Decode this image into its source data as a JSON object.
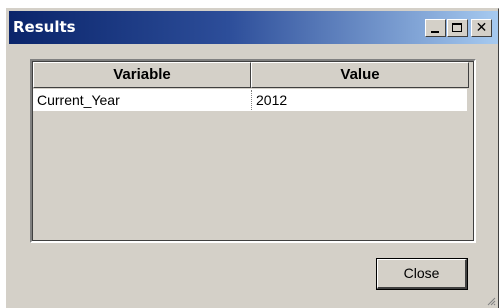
{
  "window": {
    "title": "Results",
    "controls": {
      "minimize": "minimize",
      "maximize": "maximize",
      "close_glyph": "✕"
    }
  },
  "grid": {
    "columns": [
      "Variable",
      "Value"
    ],
    "rows": [
      {
        "variable": "Current_Year",
        "value": "2012"
      }
    ]
  },
  "buttons": {
    "close_label": "Close"
  },
  "colors": {
    "title_gradient_start": "#0a246a",
    "title_gradient_end": "#a6caf0",
    "face": "#d4d0c8"
  }
}
